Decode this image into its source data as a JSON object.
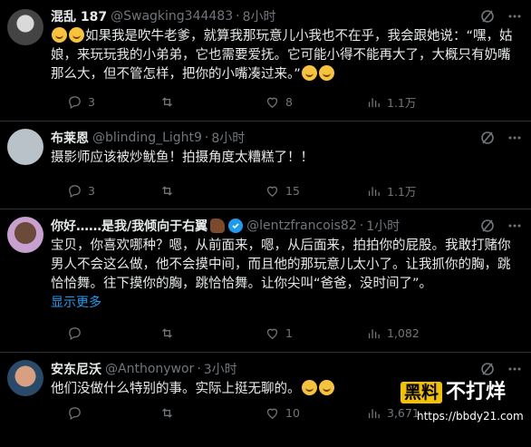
{
  "tweets": [
    {
      "name": "混乱 187",
      "handle": "@Swagking344483",
      "time": "8小时",
      "body_start": "",
      "body": "如果我是吹牛老爹，就算我那玩意儿小我也不在乎，我会跟她说：“嘿，姑娘，来玩玩我的小弟弟，它也需要爱抚。它可能小得不能再大了，大概只有奶嘴那么大，但不管怎样，把你的小嘴凑过来。”",
      "replies": "3",
      "reposts": "",
      "likes": "8",
      "views": "1.1万"
    },
    {
      "name": "布莱恩",
      "handle": "@blinding_Light9",
      "time": "8小时",
      "body": "摄影师应该被炒鱿鱼！拍摄角度太糟糕了！！",
      "replies": "3",
      "reposts": "",
      "likes": "15",
      "views": "1.1万"
    },
    {
      "name": "你好……是我/我倾向于右翼",
      "handle": "@lentzfrancois82",
      "time": "1小时",
      "body": "宝贝，你喜欢哪种？嗯，从前面来，嗯，从后面来，拍拍你的屁股。我敢打赌你男人不会这么做，他不会摸中间，而且他的那玩意儿太小了。让我抓你的胸，跳恰恰舞。往下摸你的胸，跳恰恰舞。让你尖叫“爸爸，没时间了”。",
      "show_more": "显示更多",
      "replies": "",
      "reposts": "",
      "likes": "1",
      "views": "1,082"
    },
    {
      "name": "安东尼沃",
      "handle": "@Anthonywor",
      "time": "3小时",
      "body": "他们没做什么特别的事。实际上挺无聊的。",
      "replies": "",
      "reposts": "",
      "likes": "10",
      "views": "3,671"
    }
  ],
  "separator": "·",
  "watermark": {
    "brand_box": "黑料",
    "brand_text": "不打烊",
    "url": "https://bbdy21.com"
  },
  "colors": {
    "background": "#000000",
    "text": "#e7e9ea",
    "muted": "#71767b",
    "accent": "#1d9bf0",
    "border": "#2f3336"
  }
}
